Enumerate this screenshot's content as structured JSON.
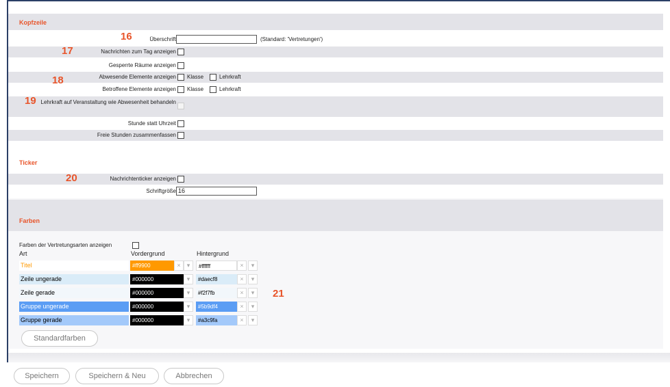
{
  "kopfzeile": {
    "title": "Kopfzeile",
    "ueberschrift_label": "Überschrift",
    "ueberschrift_value": "",
    "ueberschrift_hint": "(Standard: 'Vertretungen')",
    "nachrichten_label": "Nachrichten zum Tag anzeigen",
    "gesperrte_label": "Gesperrte Räume anzeigen",
    "abwesende_label": "Abwesende Elemente anzeigen",
    "betroffene_label": "Betroffene Elemente anzeigen",
    "klasse": "Klasse",
    "lehrkraft": "Lehrkraft",
    "veranstaltung_label": "Lehrkraft auf Veranstaltung wie Abwesenheit behandeln",
    "stunde_label": "Stunde statt Uhrzeit",
    "freie_label": "Freie Stunden zusammenfassen"
  },
  "ticker": {
    "title": "Ticker",
    "nachrichtenticker_label": "Nachrichtenticker anzeigen",
    "schriftgroesse_label": "Schriftgröße",
    "schriftgroesse_value": "16"
  },
  "farben": {
    "title": "Farben",
    "show_label": "Farben der Vertretungsarten anzeigen",
    "col_art": "Art",
    "col_vordergrund": "Vordergrund",
    "col_hintergrund": "Hintergrund",
    "rows": [
      {
        "name": "Titel",
        "fg": "#ff9900",
        "bg": "#ffffff"
      },
      {
        "name": "Zeile ungerade",
        "fg": "#000000",
        "bg": "#daecf8"
      },
      {
        "name": "Zeile gerade",
        "fg": "#000000",
        "bg": "#f2f7fb"
      },
      {
        "name": "Gruppe ungerade",
        "fg": "#000000",
        "bg": "#5b9df4"
      },
      {
        "name": "Gruppe gerade",
        "fg": "#000000",
        "bg": "#a3c9fa"
      }
    ],
    "standard_button": "Standardfarben"
  },
  "footer": {
    "save": "Speichern",
    "save_new": "Speichern & Neu",
    "cancel": "Abbrechen"
  },
  "annotations": [
    "16",
    "17",
    "18",
    "19",
    "20",
    "21"
  ],
  "icons": {
    "clear": "×",
    "dropdown": "▾"
  }
}
